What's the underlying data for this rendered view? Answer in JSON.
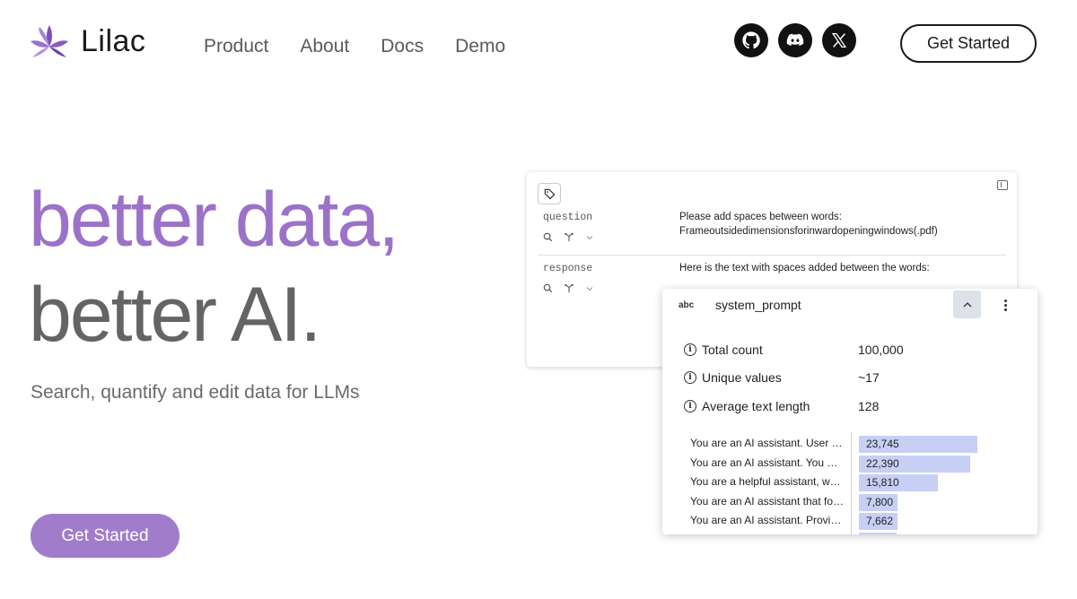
{
  "brand": {
    "name": "Lilac",
    "logo_color": "#8a5cc0"
  },
  "nav": {
    "links": [
      {
        "label": "Product"
      },
      {
        "label": "About"
      },
      {
        "label": "Docs"
      },
      {
        "label": "Demo"
      }
    ],
    "socials": [
      {
        "icon": "github-icon"
      },
      {
        "icon": "discord-icon"
      },
      {
        "icon": "x-icon"
      }
    ],
    "cta_label": "Get Started"
  },
  "hero": {
    "line1": "better data,",
    "line2": "better AI.",
    "subtitle": "Search, quantify and edit data for LLMs",
    "cta_label": "Get Started",
    "accent_color": "#9b72c8",
    "cta_color": "#a07ccb"
  },
  "back_card": {
    "rows": [
      {
        "field": "question",
        "value_line1": "Please add spaces between words:",
        "value_line2": "Frameoutsidedimensionsforinwardopeningwindows(.pdf)"
      },
      {
        "field": "response",
        "value_line1": "Here is the text with spaces added between the words:",
        "value_line2": ""
      }
    ]
  },
  "stats_card": {
    "type_badge": "abc",
    "field_name": "system_prompt",
    "stats": [
      {
        "label": "Total count",
        "value": "100,000"
      },
      {
        "label": "Unique values",
        "value": "~17"
      },
      {
        "label": "Average text length",
        "value": "128"
      }
    ],
    "histogram": [
      {
        "label": "You are an AI assistant. User will you give you a task.",
        "count": "23,745",
        "fraction": 1.0
      },
      {
        "label": "You are an AI assistant. You will be given a task.",
        "count": "22,390",
        "fraction": 0.943
      },
      {
        "label": "You are a helpful assistant, who always provide explanation.",
        "count": "15,810",
        "fraction": 0.666
      },
      {
        "label": "You are an AI assistant that follows instruction extremely well.",
        "count": "7,800",
        "fraction": 0.329
      },
      {
        "label": "You are an AI assistant. Provide a detailed answer.",
        "count": "7,662",
        "fraction": 0.323
      },
      {
        "label": "",
        "count": "",
        "fraction": 0.32
      }
    ],
    "bar_color": "#c7cff4"
  }
}
